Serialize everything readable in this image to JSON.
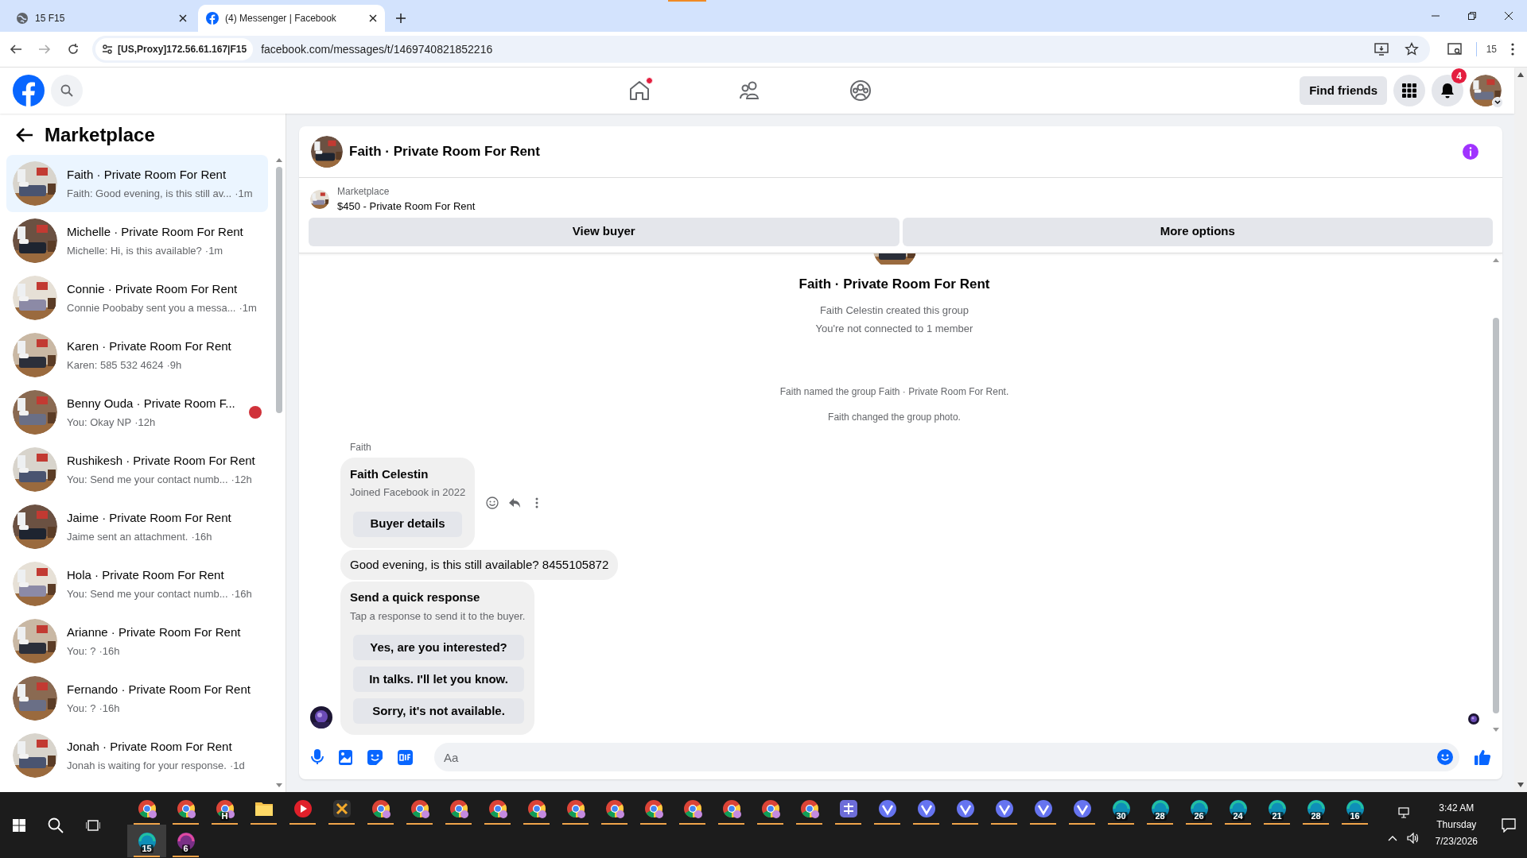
{
  "browser": {
    "tabs": [
      {
        "title": "15 F15",
        "kind": "globe",
        "selected": false
      },
      {
        "title": "(4) Messenger | Facebook",
        "kind": "facebook",
        "selected": true
      }
    ],
    "proxy_label": "[US,Proxy]172.56.61.167|F15",
    "url": "facebook.com/messages/t/1469740821852216",
    "profile_count": "15"
  },
  "header": {
    "nav": [
      {
        "kind": "home",
        "dot": true
      },
      {
        "kind": "friends",
        "dot": false
      },
      {
        "kind": "groups",
        "dot": false
      }
    ],
    "find_friends": "Find friends",
    "notification_count": "4"
  },
  "sidebar": {
    "title": "Marketplace",
    "conversations": [
      {
        "title": "Faith · Private Room For Rent",
        "preview": "Faith: Good evening, is this still av...",
        "time": "·1m",
        "selected": true,
        "seen": false
      },
      {
        "title": "Michelle · Private Room For Rent",
        "preview": "Michelle: Hi, is this available?",
        "time": "·1m",
        "selected": false,
        "seen": false
      },
      {
        "title": "Connie · Private Room For Rent",
        "preview": "Connie Poobaby sent you a messa...",
        "time": "·1m",
        "selected": false,
        "seen": false
      },
      {
        "title": "Karen · Private Room For Rent",
        "preview": "Karen: 585 532 4624",
        "time": "·9h",
        "selected": false,
        "seen": false
      },
      {
        "title": "Benny Ouda · Private Room F...",
        "preview": "You: Okay NP",
        "time": "·12h",
        "selected": false,
        "seen": true
      },
      {
        "title": "Rushikesh · Private Room For Rent",
        "preview": "You: Send me your contact numb...",
        "time": "·12h",
        "selected": false,
        "seen": false
      },
      {
        "title": "Jaime · Private Room For Rent",
        "preview": "Jaime sent an attachment.",
        "time": "·16h",
        "selected": false,
        "seen": false
      },
      {
        "title": "Hola · Private Room For Rent",
        "preview": "You: Send me your contact numb...",
        "time": "·16h",
        "selected": false,
        "seen": false
      },
      {
        "title": "Arianne · Private Room For Rent",
        "preview": "You: ?",
        "time": "·16h",
        "selected": false,
        "seen": false
      },
      {
        "title": "Fernando · Private Room For Rent",
        "preview": "You: ?",
        "time": "·16h",
        "selected": false,
        "seen": false
      },
      {
        "title": "Jonah · Private Room For Rent",
        "preview": "Jonah is waiting for your response.",
        "time": "·1d",
        "selected": false,
        "seen": false
      }
    ]
  },
  "chat": {
    "title": "Faith · Private Room For Rent",
    "listing": {
      "source": "Marketplace",
      "title": "$450 - Private Room For Rent"
    },
    "actions": [
      "View buyer",
      "More options"
    ],
    "group_name": "Faith · Private Room For Rent",
    "group_info": [
      "Faith Celestin created this group",
      "You're not connected to 1 member"
    ],
    "events": [
      "Faith named the group Faith · Private Room For Rent.",
      "Faith changed the group photo."
    ],
    "sender": "Faith",
    "buyer_card": {
      "name": "Faith Celestin",
      "subtitle": "Joined Facebook in 2022",
      "button": "Buyer details"
    },
    "message": "Good evening, is this still available? 8455105872",
    "quick_response": {
      "title": "Send a quick response",
      "hint": "Tap a response to send it to the buyer.",
      "options": [
        "Yes, are you interested?",
        "In talks. I'll let you know.",
        "Sorry, it's not available."
      ]
    },
    "composer": {
      "placeholder": "Aa"
    }
  },
  "taskbar": {
    "rows": [
      [
        {
          "kind": "chrome",
          "selected": false
        },
        {
          "kind": "chrome",
          "selected": false
        },
        {
          "kind": "chrome",
          "badge": "H",
          "selected": false
        },
        {
          "kind": "folder",
          "selected": false
        },
        {
          "kind": "red",
          "selected": false
        },
        {
          "kind": "x",
          "selected": false
        },
        {
          "kind": "chrome",
          "selected": false
        },
        {
          "kind": "chrome",
          "selected": false
        },
        {
          "kind": "chrome",
          "selected": false
        },
        {
          "kind": "chrome",
          "selected": false
        },
        {
          "kind": "chrome",
          "selected": false
        },
        {
          "kind": "chrome",
          "selected": false
        },
        {
          "kind": "chrome",
          "selected": false
        },
        {
          "kind": "chrome",
          "selected": false
        },
        {
          "kind": "chrome",
          "selected": false
        },
        {
          "kind": "chrome",
          "selected": false
        },
        {
          "kind": "chrome",
          "selected": false
        },
        {
          "kind": "chrome",
          "selected": false
        },
        {
          "kind": "s",
          "selected": false
        },
        {
          "kind": "v",
          "selected": false
        },
        {
          "kind": "v",
          "selected": false
        },
        {
          "kind": "v",
          "selected": false
        },
        {
          "kind": "v",
          "selected": false
        },
        {
          "kind": "v",
          "selected": false
        },
        {
          "kind": "v",
          "selected": false
        },
        {
          "kind": "gauge",
          "badge": "30",
          "selected": false
        },
        {
          "kind": "gauge",
          "badge": "28",
          "selected": false
        },
        {
          "kind": "gauge",
          "badge": "26",
          "selected": false
        },
        {
          "kind": "gauge",
          "badge": "24",
          "selected": false
        },
        {
          "kind": "gauge",
          "badge": "21",
          "selected": false
        },
        {
          "kind": "gauge",
          "badge": "28",
          "selected": false
        },
        {
          "kind": "gauge",
          "badge": "16",
          "selected": false
        }
      ],
      [
        {
          "kind": "gauge",
          "badge": "15",
          "selected": true
        },
        {
          "kind": "gauge-purple",
          "badge": "6",
          "selected": false
        }
      ]
    ],
    "time": "3:42 AM",
    "day": "Thursday",
    "date": "7/23/2026"
  }
}
